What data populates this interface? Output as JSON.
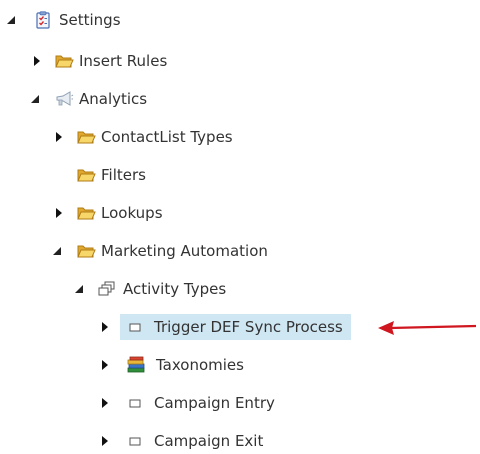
{
  "tree": {
    "nodes": [
      {
        "key": "settings",
        "label": "Settings",
        "icon": "checklist-icon",
        "state": "expanded"
      },
      {
        "key": "insert_rules",
        "label": "Insert Rules",
        "icon": "folder-icon",
        "state": "collapsed"
      },
      {
        "key": "analytics",
        "label": "Analytics",
        "icon": "megaphone-icon",
        "state": "expanded"
      },
      {
        "key": "contactlist_types",
        "label": "ContactList Types",
        "icon": "folder-icon",
        "state": "collapsed"
      },
      {
        "key": "filters",
        "label": "Filters",
        "icon": "folder-icon",
        "state": "leaf"
      },
      {
        "key": "lookups",
        "label": "Lookups",
        "icon": "folder-icon",
        "state": "collapsed"
      },
      {
        "key": "marketing_automation",
        "label": "Marketing Automation",
        "icon": "folder-icon",
        "state": "expanded"
      },
      {
        "key": "activity_types",
        "label": "Activity Types",
        "icon": "windows-icon",
        "state": "expanded"
      },
      {
        "key": "trigger_def",
        "label": "Trigger DEF Sync Process",
        "icon": "item-icon",
        "state": "collapsed",
        "selected": true
      },
      {
        "key": "taxonomies",
        "label": "Taxonomies",
        "icon": "books-icon",
        "state": "collapsed"
      },
      {
        "key": "campaign_entry",
        "label": "Campaign Entry",
        "icon": "item-icon",
        "state": "collapsed"
      },
      {
        "key": "campaign_exit",
        "label": "Campaign Exit",
        "icon": "item-icon",
        "state": "collapsed"
      }
    ]
  },
  "colors": {
    "selection": "#cfe6f3",
    "annotation_arrow": "#d0161f",
    "folder": "#f3c64f"
  }
}
